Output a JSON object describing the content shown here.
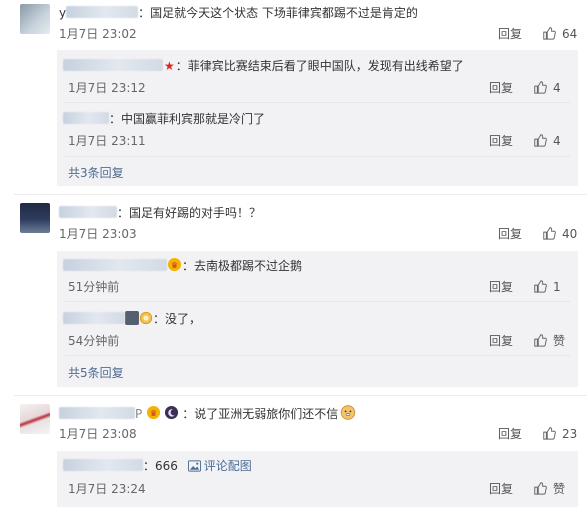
{
  "comments": [
    {
      "name_visible": "y",
      "text": "：国足就今天这个状态 下场菲律宾都踢不过是肯定的",
      "time": "1月7日 23:02",
      "reply": "回复",
      "likes": "64",
      "replies": [
        {
          "text": "：菲律宾比赛结束后看了眼中国队，发现有出线希望了",
          "time": "1月7日 23:12",
          "reply": "回复",
          "likes": "4"
        },
        {
          "text": "：中国赢菲利宾那就是冷门了",
          "time": "1月7日 23:11",
          "reply": "回复",
          "likes": "4"
        }
      ],
      "more": "共3条回复"
    },
    {
      "text": "：国足有好踢的对手吗！？",
      "time": "1月7日 23:03",
      "reply": "回复",
      "likes": "40",
      "replies": [
        {
          "text": "：去南极都踢不过企鹅",
          "time": "51分钟前",
          "reply": "回复",
          "likes": "1"
        },
        {
          "text": "：没了，",
          "time": "54分钟前",
          "reply": "回复",
          "likes": "赞"
        }
      ],
      "more": "共5条回复"
    },
    {
      "name_visible": "P",
      "text": "：说了亚洲无弱旅你们还不信",
      "time": "1月7日 23:08",
      "reply": "回复",
      "likes": "23",
      "replies": [
        {
          "text": "：666",
          "link": "评论配图",
          "time": "1月7日 23:24",
          "reply": "回复",
          "likes": "赞"
        }
      ]
    }
  ],
  "colors": {
    "link": "#506c8d",
    "meta": "#666666",
    "reply_bg": "#f2f2f5",
    "star": "#e0261b"
  },
  "icons": [
    "thumbs-up-icon",
    "image-icon",
    "vip-badge-icon",
    "star-icon",
    "doge-emoji"
  ]
}
